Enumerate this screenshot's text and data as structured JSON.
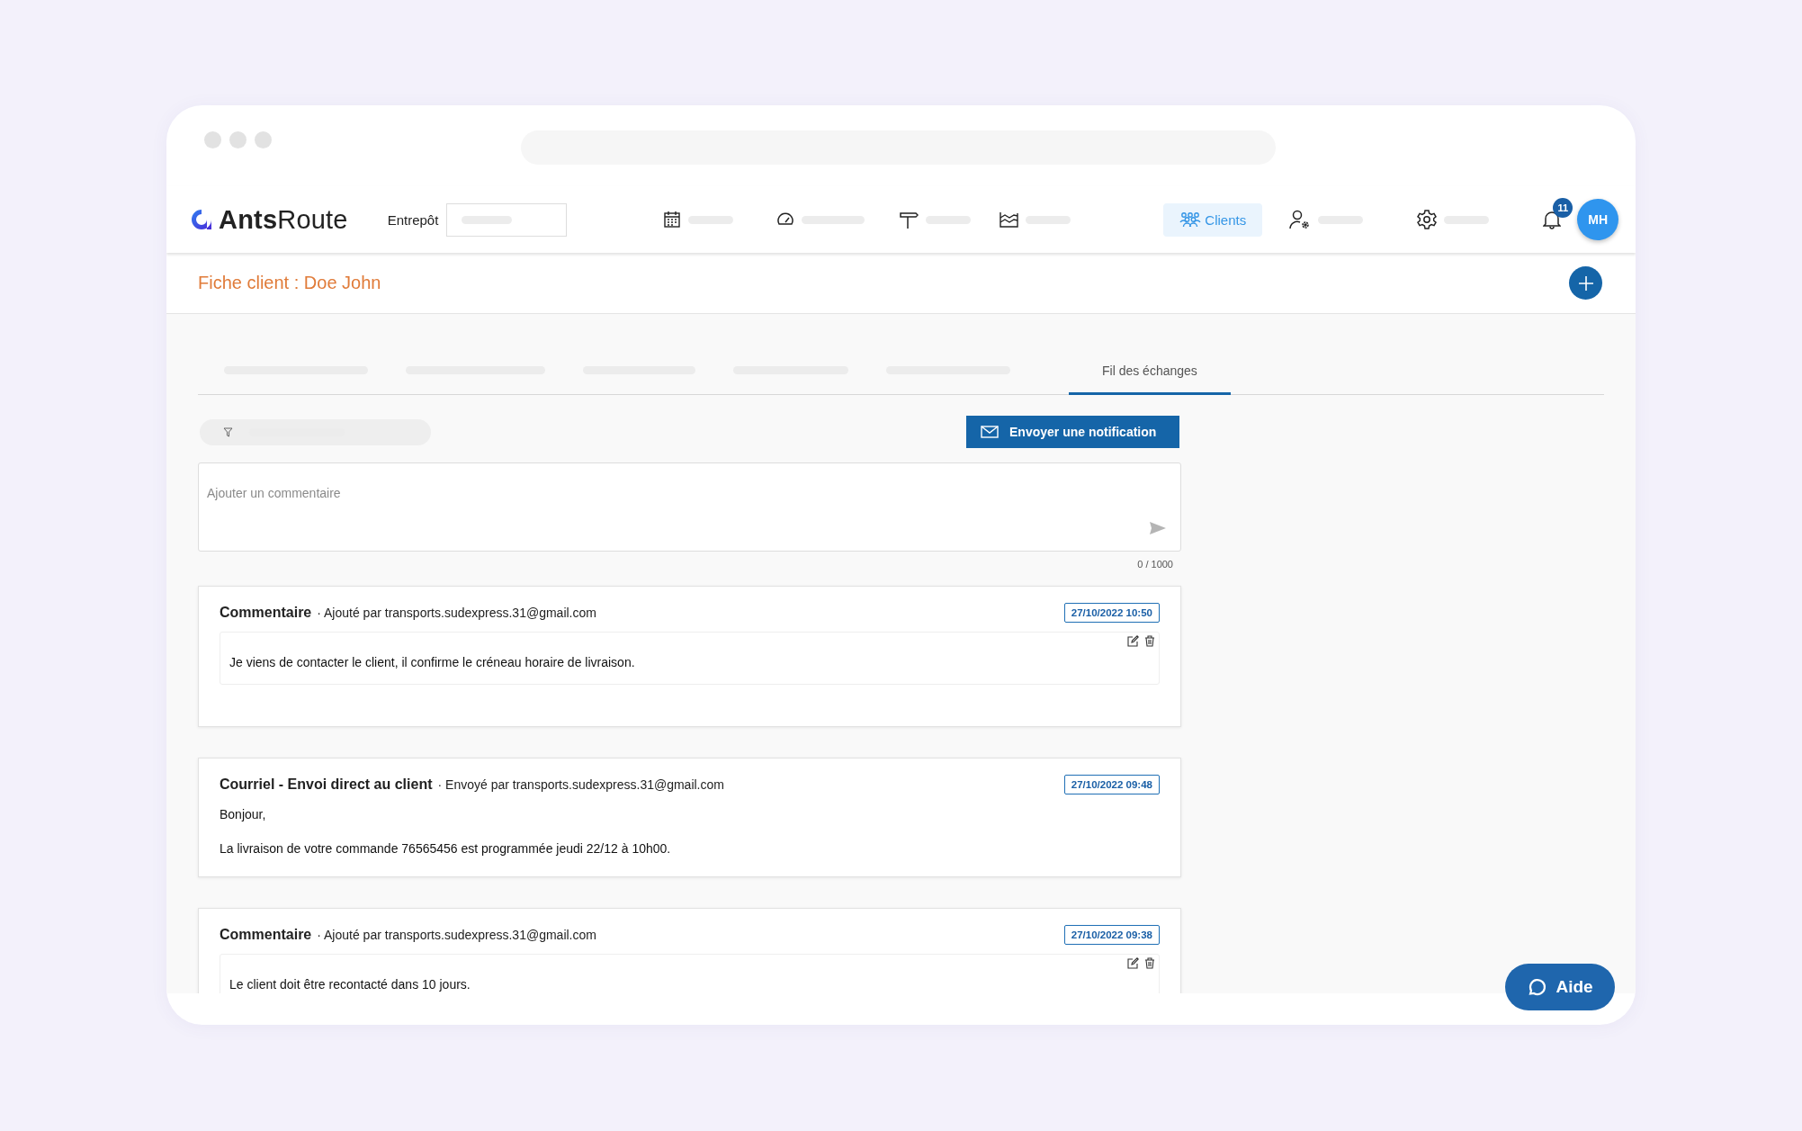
{
  "app": {
    "logo": "**Ants**Route"
  },
  "header": {
    "warehouse_label": "Entrepôt",
    "nav": [
      {
        "kind": "calendar",
        "selected": false
      },
      {
        "kind": "gauge",
        "selected": false
      },
      {
        "kind": "signpost",
        "selected": false
      },
      {
        "kind": "chart",
        "selected": false
      },
      {
        "kind": "clients",
        "label": "Clients",
        "selected": true
      },
      {
        "kind": "user-settings",
        "selected": false
      },
      {
        "kind": "settings",
        "selected": false
      }
    ],
    "notification_count": "11",
    "avatar": "MH"
  },
  "page_title": "Fiche client : Doe John",
  "tabs": [
    {
      "selected": false
    },
    {
      "selected": false
    },
    {
      "selected": false
    },
    {
      "selected": false
    },
    {
      "selected": false
    },
    {
      "label": "Fil des échanges",
      "selected": true
    }
  ],
  "send_notification_button": "Envoyer une notification",
  "comment_field": {
    "placeholder": "Ajouter un commentaire",
    "counter": "0 / 1000"
  },
  "feed": [
    {
      "kind": "comment",
      "type": "Commentaire",
      "meta": "· Ajouté par transports.sudexpress.31@gmail.com",
      "date": "27/10/2022 10:50",
      "body": [
        "Je viens de contacter le client, il confirme le créneau horaire de livraison."
      ]
    },
    {
      "kind": "email",
      "type": "Courriel - Envoi direct au client",
      "meta": "· Envoyé par transports.sudexpress.31@gmail.com",
      "date": "27/10/2022 09:48",
      "body": [
        "Bonjour,",
        "La livraison de votre commande 76565456 est programmée jeudi 22/12 à 10h00."
      ]
    },
    {
      "kind": "comment",
      "type": "Commentaire",
      "meta": "· Ajouté par transports.sudexpress.31@gmail.com",
      "date": "27/10/2022 09:38",
      "body": [
        "Le client doit être recontacté dans 10 jours."
      ]
    }
  ],
  "help_button": "Aide"
}
